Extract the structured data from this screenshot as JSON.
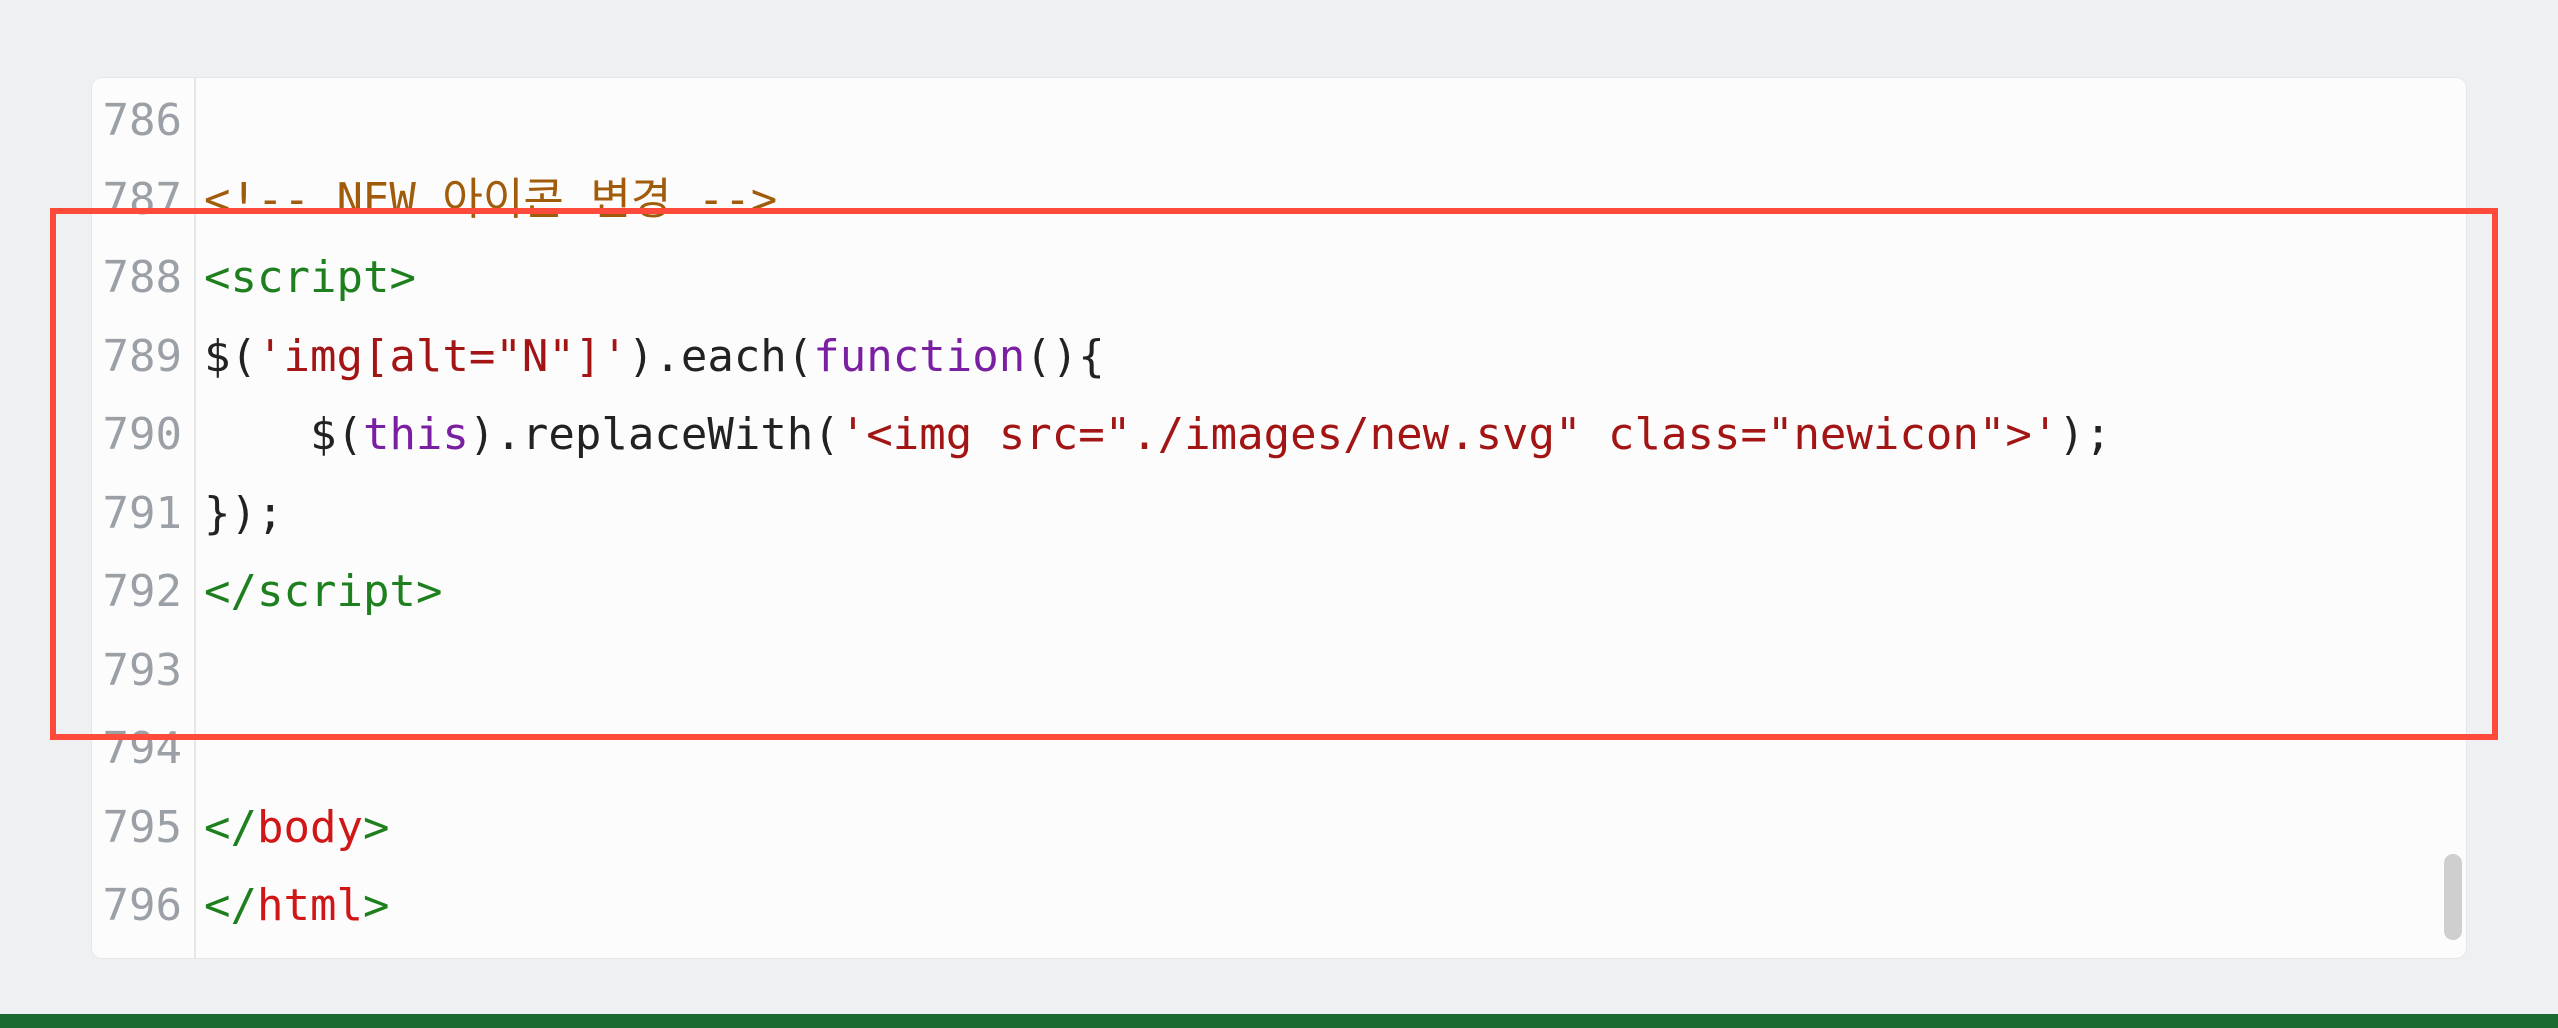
{
  "colors": {
    "highlight_border": "#fd4a3a",
    "background": "#eef0f2",
    "footer_bar": "#1a6b2f",
    "gutter_text": "#9aa0a6",
    "comment": "#a15c0b",
    "tag": "#1e7f1e",
    "tagname": "#d01616",
    "string": "#a31515",
    "keyword": "#7b1fa2"
  },
  "line_numbers": [
    "786",
    "787",
    "788",
    "789",
    "790",
    "791",
    "792",
    "793",
    "794",
    "795",
    "796"
  ],
  "code": {
    "l786": "",
    "l787": {
      "t1": "<!-- ",
      "t2": "NEW",
      "t3": " 아이콘 변경 ",
      "t4": "-->"
    },
    "l788": {
      "t1": "<",
      "t2": "script",
      "t3": ">"
    },
    "l789": {
      "t1": "$(",
      "t2": "'img[alt=\"N\"]'",
      "t3": ").each(",
      "t4": "function",
      "t5": "(){"
    },
    "l790": {
      "indent": "    ",
      "t1": "$(",
      "t2": "this",
      "t3": ").replaceWith(",
      "t4": "'<img src=\"./images/new.svg\" class=\"newicon\">'",
      "t5": ");"
    },
    "l791": {
      "t1": "});"
    },
    "l792": {
      "t1": "</",
      "t2": "script",
      "t3": ">"
    },
    "l793": "",
    "l794": "",
    "l795": {
      "t1": "</",
      "t2": "body",
      "t3": ">"
    },
    "l796": {
      "t1": "</",
      "t2": "html",
      "t3": ">"
    }
  }
}
